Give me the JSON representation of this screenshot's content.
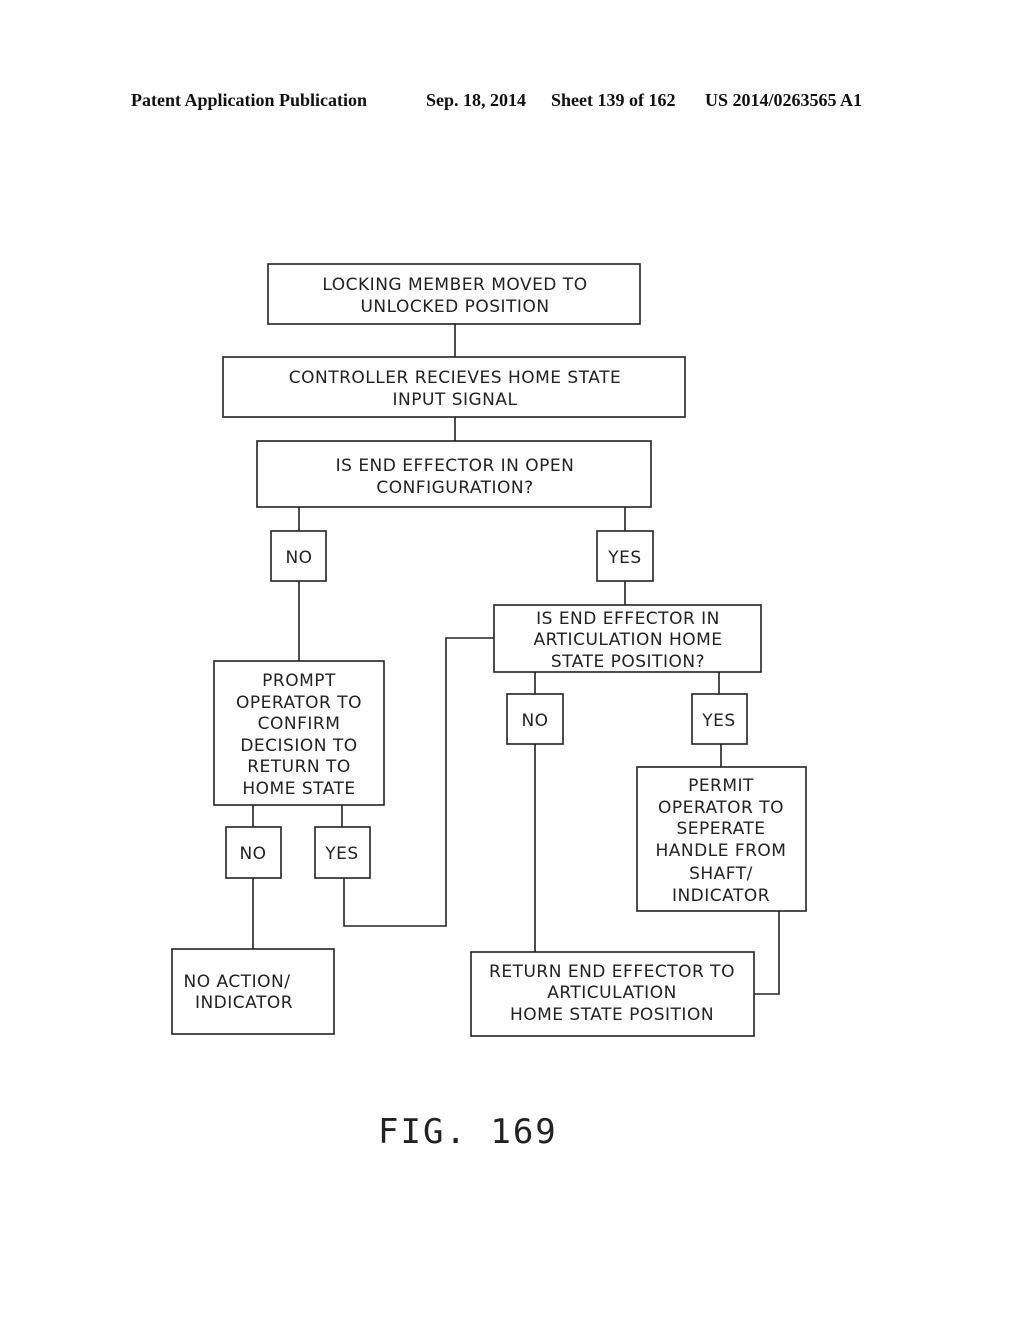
{
  "header": {
    "publication": "Patent Application Publication",
    "date": "Sep. 18, 2014",
    "sheet": "Sheet 139 of 162",
    "number": "US 2014/0263565 A1"
  },
  "nodes": {
    "locking": [
      "LOCKING MEMBER MOVED TO",
      "UNLOCKED POSITION"
    ],
    "controller": [
      "CONTROLLER RECIEVES HOME STATE",
      "INPUT SIGNAL"
    ],
    "open_q": [
      "IS END EFFECTOR IN OPEN",
      "CONFIGURATION?"
    ],
    "no1": "NO",
    "yes1": "YES",
    "prompt": [
      "PROMPT",
      "OPERATOR TO",
      "CONFIRM",
      "DECISION TO",
      "RETURN TO",
      "HOME STATE"
    ],
    "articulation_q": [
      "IS END EFFECTOR IN",
      "ARTICULATION HOME",
      "STATE POSITION?"
    ],
    "no2": "NO",
    "yes2": "YES",
    "no3": "NO",
    "yes3": "YES",
    "permit": [
      "PERMIT",
      "OPERATOR TO",
      "SEPERATE",
      "HANDLE FROM",
      "SHAFT/",
      "INDICATOR"
    ],
    "no_action": [
      "NO ACTION/",
      "INDICATOR"
    ],
    "return": [
      "RETURN END EFFECTOR TO",
      "ARTICULATION",
      "HOME STATE POSITION"
    ]
  },
  "figure_label": "FIG. 169"
}
